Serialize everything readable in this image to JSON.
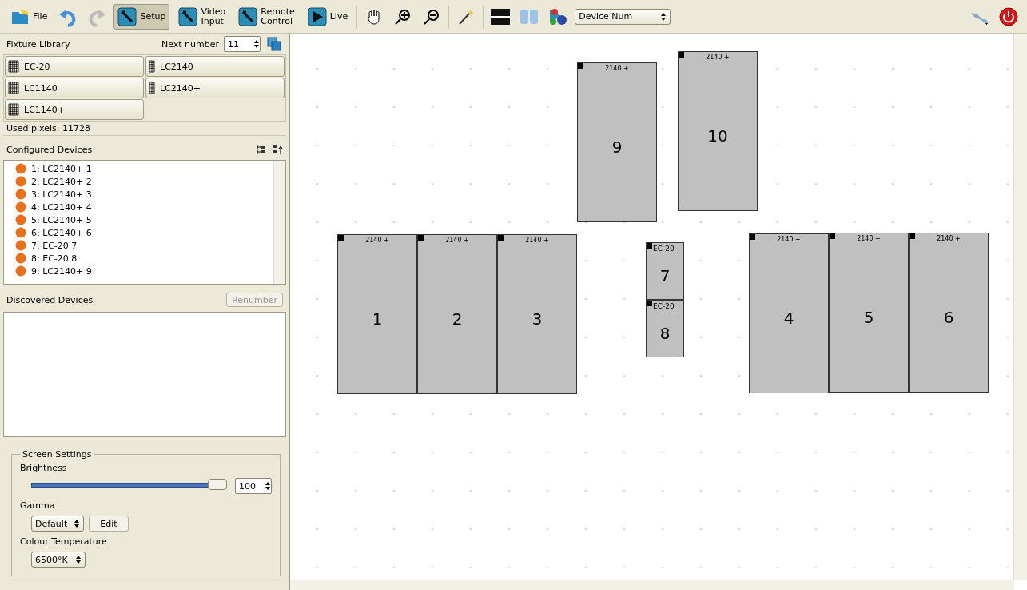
{
  "toolbar": {
    "file": "File",
    "undo_disabled": false,
    "redo_disabled": true,
    "modes": [
      {
        "label": "Setup",
        "selected": true
      },
      {
        "label": "Video\nInput",
        "selected": false
      },
      {
        "label": "Remote\nControl",
        "selected": false
      },
      {
        "label": "Live",
        "selected": false
      }
    ],
    "view_select": "Device Num"
  },
  "fixture_library": {
    "title": "Fixture Library",
    "next_number_label": "Next number",
    "next_number": "11",
    "fixtures": [
      {
        "label": "EC-20",
        "kind": "wide"
      },
      {
        "label": "LC2140",
        "kind": "narrow"
      },
      {
        "label": "LC1140",
        "kind": "wide"
      },
      {
        "label": "LC2140+",
        "kind": "narrow"
      },
      {
        "label": "LC1140+",
        "kind": "wide"
      }
    ],
    "used_pixels": "Used pixels: 11728"
  },
  "configured_devices": {
    "title": "Configured Devices",
    "items": [
      "1: LC2140+ 1",
      "2: LC2140+ 2",
      "3: LC2140+ 3",
      "4: LC2140+ 4",
      "5: LC2140+ 5",
      "6: LC2140+ 6",
      "7: EC-20 7",
      "8: EC-20 8",
      "9: LC2140+ 9"
    ]
  },
  "discovered_devices": {
    "title": "Discovered Devices",
    "renumber": "Renumber",
    "renumber_disabled": true
  },
  "screen_settings": {
    "title": "Screen Settings",
    "brightness_label": "Brightness",
    "brightness": {
      "level": 1.0
    },
    "brightness_value": "100",
    "gamma_label": "Gamma",
    "gamma": "Default",
    "edit": "Edit",
    "colour_temperature_label": "Colour Temperature",
    "colour_temperature": "6500°K"
  },
  "canvas": {
    "fixtures": [
      {
        "type": "2140 +",
        "number": "9"
      },
      {
        "type": "2140 +",
        "number": "10"
      },
      {
        "type": "2140 +",
        "number": "1"
      },
      {
        "type": "2140 +",
        "number": "2"
      },
      {
        "type": "2140 +",
        "number": "3"
      },
      {
        "type": "EC-20",
        "number": "7"
      },
      {
        "type": "EC-20",
        "number": "8"
      },
      {
        "type": "2140 +",
        "number": "4"
      },
      {
        "type": "2140 +",
        "number": "5"
      },
      {
        "type": "2140 +",
        "number": "6"
      }
    ]
  }
}
